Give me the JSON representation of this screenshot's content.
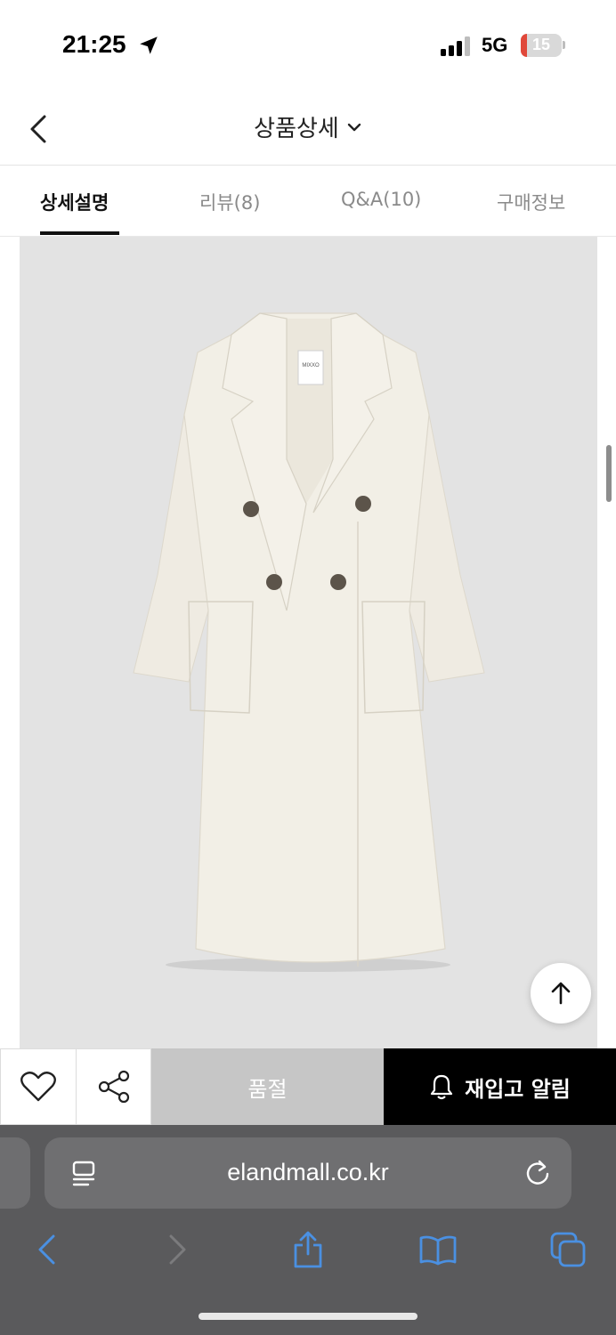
{
  "status_bar": {
    "time": "21:25",
    "network": "5G",
    "battery_level": "15",
    "battery_fraction": 0.15
  },
  "header": {
    "title": "상품상세",
    "back_icon": "chevron-left-icon",
    "title_dropdown_icon": "chevron-down-icon"
  },
  "tabs": [
    {
      "label": "상세설명",
      "active": true
    },
    {
      "label": "리뷰(8)",
      "active": false
    },
    {
      "label": "Q&A(10)",
      "active": false
    },
    {
      "label": "구매정보",
      "active": false
    }
  ],
  "product": {
    "image_background": "#e3e3e3",
    "coat_color": "#f2efe6",
    "label_text": "MIXXO",
    "scroll_top_icon": "arrow-up-icon"
  },
  "actions": {
    "wish_icon": "heart-icon",
    "share_icon": "share-icon",
    "soldout_label": "품절",
    "restock_label": "재입고 알림",
    "restock_icon": "bell-icon"
  },
  "browser": {
    "url": "elandmall.co.kr",
    "reader_icon": "reader-icon",
    "reload_icon": "reload-icon",
    "toolbar": [
      "back-icon",
      "forward-icon",
      "share-icon",
      "bookmarks-icon",
      "tabs-icon"
    ],
    "accent": "#4a90e2"
  }
}
